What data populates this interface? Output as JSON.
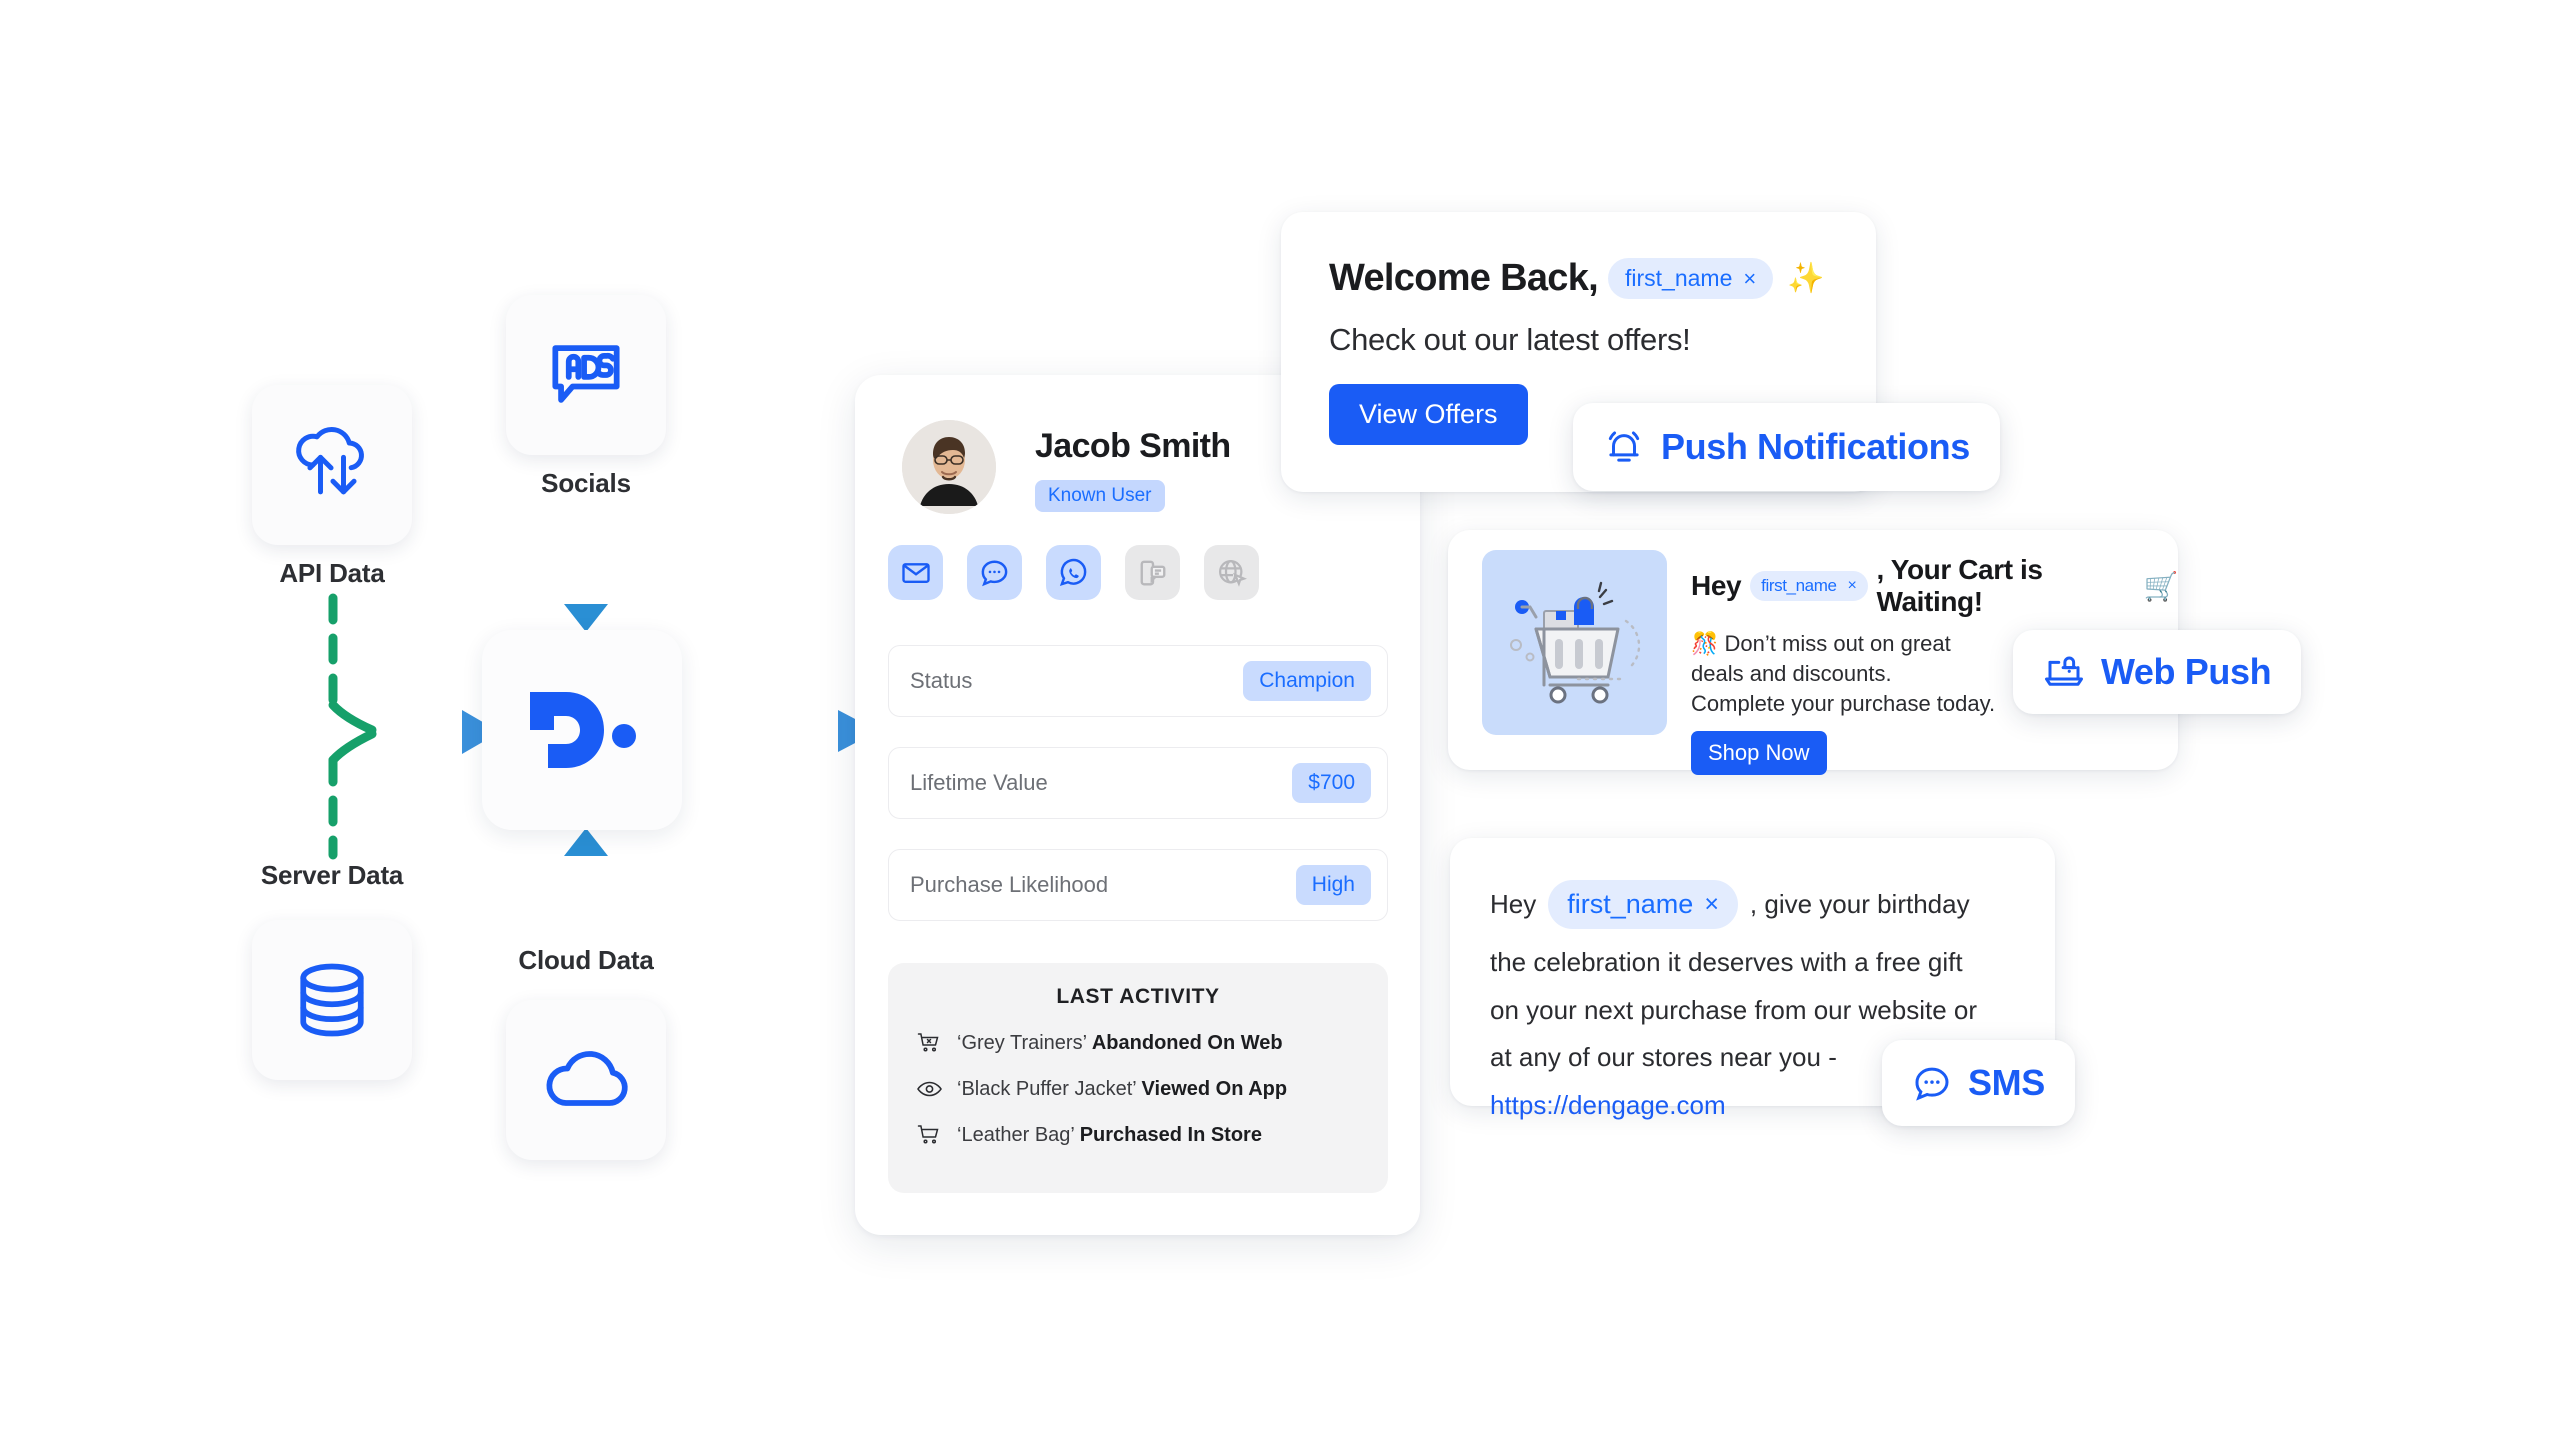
{
  "colors": {
    "brand_blue": "#1a5cf5",
    "chip_blue_bg": "#c9dbfe",
    "chip_blue_text": "#1a6dff",
    "token_bg": "#e3ecfe",
    "flow_green": "#16a06a",
    "flow_blue": "#2a8fd4",
    "tile_bg": "#fbfbfc",
    "muted_grey": "#6d7076"
  },
  "sources": {
    "api": {
      "label": "API Data",
      "icon": "cloud-sync-icon"
    },
    "socials": {
      "label": "Socials",
      "icon": "ads-speech-bubble-icon"
    },
    "server": {
      "label": "Server Data",
      "icon": "database-icon"
    },
    "cloud": {
      "label": "Cloud Data",
      "icon": "cloud-icon"
    },
    "hub": {
      "icon": "dengage-d-logo"
    }
  },
  "profile": {
    "name": "Jacob Smith",
    "badge": "Known User",
    "avatar": "user-avatar",
    "channels": [
      {
        "name": "email-channel-icon",
        "enabled": true
      },
      {
        "name": "chat-channel-icon",
        "enabled": true
      },
      {
        "name": "whatsapp-channel-icon",
        "enabled": true
      },
      {
        "name": "in-app-message-channel-icon",
        "enabled": false
      },
      {
        "name": "web-personalization-channel-icon",
        "enabled": false
      }
    ],
    "attributes": [
      {
        "label": "Status",
        "value": "Champion"
      },
      {
        "label": "Lifetime Value",
        "value": "$700"
      },
      {
        "label": "Purchase Likelihood",
        "value": "High"
      }
    ],
    "last_activity": {
      "title": "LAST ACTIVITY",
      "items": [
        {
          "icon": "cart-remove-icon",
          "product": "‘Grey Trainers’",
          "action": "Abandoned On Web"
        },
        {
          "icon": "eye-icon",
          "product": "‘Black Puffer Jacket’",
          "action": "Viewed On App"
        },
        {
          "icon": "cart-icon",
          "product": "‘Leather Bag’",
          "action": "Purchased In Store"
        }
      ]
    }
  },
  "welcome_card": {
    "heading": "Welcome Back,",
    "token": "first_name",
    "token_remove": "×",
    "sparkle": "✨",
    "subtitle": "Check out our latest offers!",
    "button": "View Offers"
  },
  "cart_card": {
    "thumb": "shopping-cart-illustration",
    "heading_prefix": "Hey",
    "token": "first_name",
    "token_remove": "×",
    "heading_suffix": ", Your Cart is Waiting!",
    "heading_emoji": "🛒",
    "body_emoji": "🎊",
    "body_line1": "Don’t miss out on great",
    "body_line2": "deals and discounts.",
    "body_line3": "Complete your purchase today.",
    "button": "Shop Now"
  },
  "sms_card": {
    "prefix": "Hey",
    "token": "first_name",
    "token_remove": "×",
    "line1_suffix": ", give your birthday",
    "line2": "the celebration it deserves with a free gift",
    "line3": "on your next purchase from our website or",
    "line4": "at any of our stores near you -",
    "link": "https://dengage.com"
  },
  "badges": {
    "push": {
      "label": "Push Notifications",
      "icon": "bell-icon"
    },
    "web_push": {
      "label": "Web Push",
      "icon": "laptop-bell-icon"
    },
    "sms": {
      "label": "SMS",
      "icon": "speech-bubble-dots-icon"
    }
  }
}
